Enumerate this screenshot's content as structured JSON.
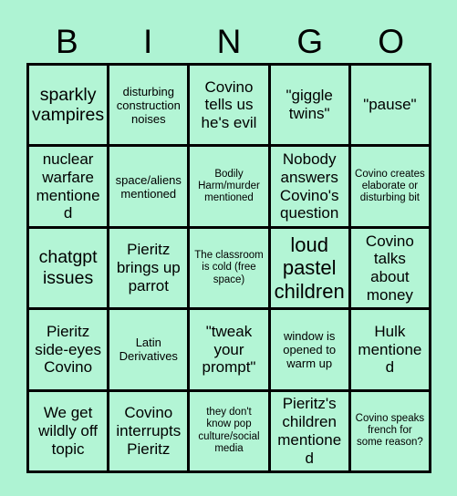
{
  "card": {
    "header_letters": [
      "B",
      "I",
      "N",
      "G",
      "O"
    ],
    "background_color": "#aef3d3",
    "cell_color": "#b3f5d5",
    "line_color": "#000000",
    "text_color": "#000000",
    "rows": 5,
    "columns": 5,
    "cells": [
      {
        "text": "sparkly vampires",
        "size": "lg"
      },
      {
        "text": "disturbing construction noises",
        "size": "sm"
      },
      {
        "text": "Covino tells us he's evil",
        "size": "md"
      },
      {
        "text": "\"giggle twins\"",
        "size": "md"
      },
      {
        "text": "\"pause\"",
        "size": "md"
      },
      {
        "text": "nuclear warfare mentioned",
        "size": "md"
      },
      {
        "text": "space/aliens mentioned",
        "size": "sm"
      },
      {
        "text": "Bodily Harm/murder mentioned",
        "size": "xs"
      },
      {
        "text": "Nobody answers Covino's question",
        "size": "md"
      },
      {
        "text": "Covino creates elaborate or disturbing bit",
        "size": "xs"
      },
      {
        "text": "chatgpt issues",
        "size": "lg"
      },
      {
        "text": "Pieritz brings up parrot",
        "size": "md"
      },
      {
        "text": "The classroom is cold (free space)",
        "size": "xs"
      },
      {
        "text": "loud pastel children",
        "size": "xl"
      },
      {
        "text": "Covino talks about money",
        "size": "md"
      },
      {
        "text": "Pieritz side-eyes Covino",
        "size": "md"
      },
      {
        "text": "Latin Derivatives",
        "size": "sm"
      },
      {
        "text": "\"tweak your prompt\"",
        "size": "md"
      },
      {
        "text": "window is opened to warm up",
        "size": "sm"
      },
      {
        "text": "Hulk mentioned",
        "size": "md"
      },
      {
        "text": "We get wildly off topic",
        "size": "md"
      },
      {
        "text": "Covino interrupts Pieritz",
        "size": "md"
      },
      {
        "text": "they don't know pop culture/social media",
        "size": "xs"
      },
      {
        "text": "Pieritz's children mentioned",
        "size": "md"
      },
      {
        "text": "Covino speaks french for some reason?",
        "size": "xs"
      }
    ]
  }
}
